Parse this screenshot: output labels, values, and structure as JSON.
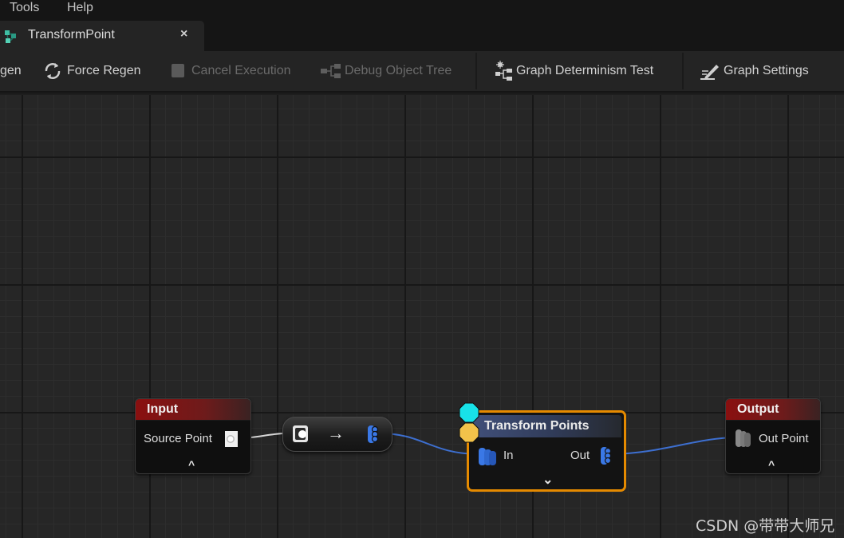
{
  "menu": {
    "items": [
      "Tools",
      "Help"
    ]
  },
  "tab": {
    "title": "TransformPoint",
    "close_glyph": "×",
    "icon": "pcg-graph-icon"
  },
  "toolbar": {
    "regen_label": "gen",
    "force_regen_label": "Force Regen",
    "cancel_execution_label": "Cancel Execution",
    "debug_object_tree_label": "Debug Object Tree",
    "graph_determinism_test_label": "Graph Determinism Test",
    "graph_settings_label": "Graph Settings"
  },
  "graph": {
    "input_node": {
      "title": "Input",
      "pin_label": "Source Point",
      "collapse_glyph": "^",
      "header_color": "#8a1010"
    },
    "conversion_node": {
      "arrow_glyph": "→"
    },
    "transform_node": {
      "title": "Transform Points",
      "in_label": "In",
      "out_label": "Out",
      "expand_glyph": "⌄",
      "accent": "#e58a00",
      "header_color": "#41507a"
    },
    "output_node": {
      "title": "Output",
      "pin_label": "Out Point",
      "collapse_glyph": "^",
      "header_color": "#8a1010"
    },
    "wire_color": "#3d6fd0"
  },
  "watermark": "CSDN @带带大师兄"
}
